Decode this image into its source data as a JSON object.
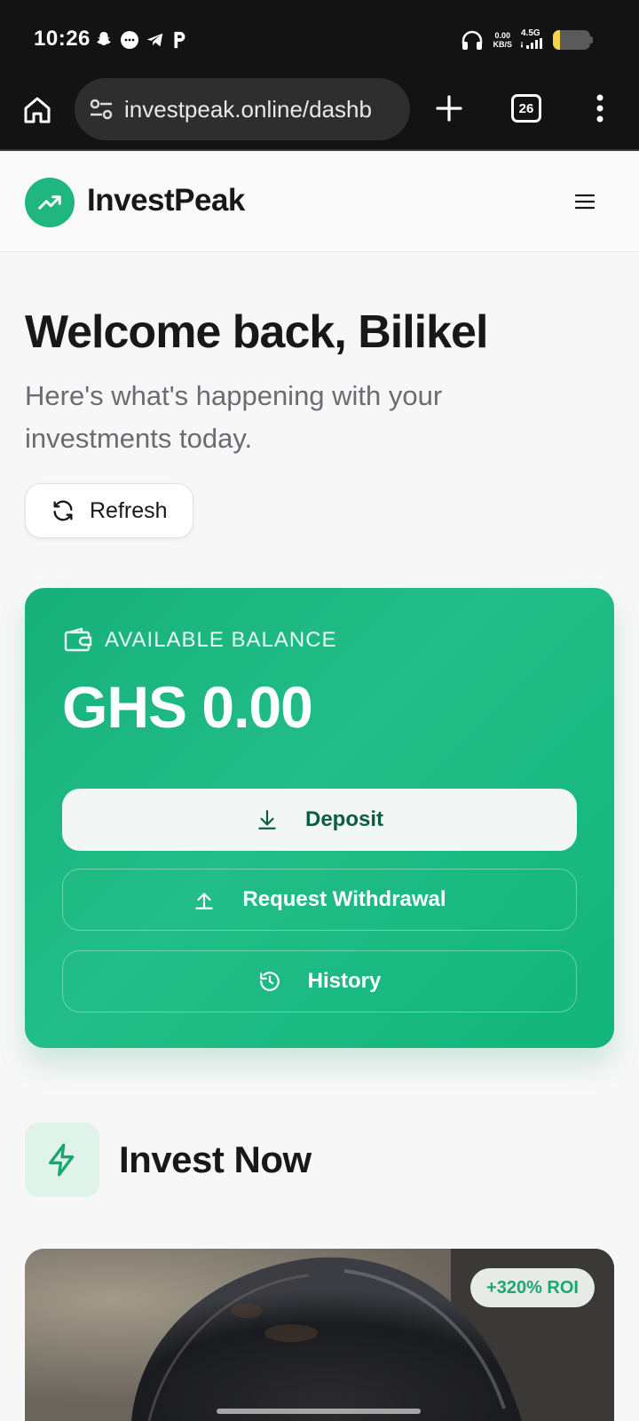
{
  "status_bar": {
    "time": "10:26",
    "speed_value": "0.00",
    "speed_unit": "KB/S",
    "network": "4.5G",
    "notifications": [
      "snapchat-icon",
      "messages-icon",
      "telegram-icon",
      "p-app-icon"
    ],
    "battery_level": 0.2,
    "battery_color": "#f5d547"
  },
  "browser": {
    "url": "investpeak.online/dashb",
    "tab_count": "26"
  },
  "header": {
    "brand": "InvestPeak",
    "brand_color": "#1fb67f"
  },
  "welcome": {
    "title": "Welcome back, Bilikel",
    "subtitle": "Here's what's happening with your investments today.",
    "refresh_label": "Refresh"
  },
  "balance": {
    "label": "AVAILABLE BALANCE",
    "amount": "GHS 0.00",
    "deposit_label": "Deposit",
    "withdraw_label": "Request Withdrawal",
    "history_label": "History"
  },
  "invest": {
    "title": "Invest Now",
    "roi_badge": "+320% ROI"
  }
}
